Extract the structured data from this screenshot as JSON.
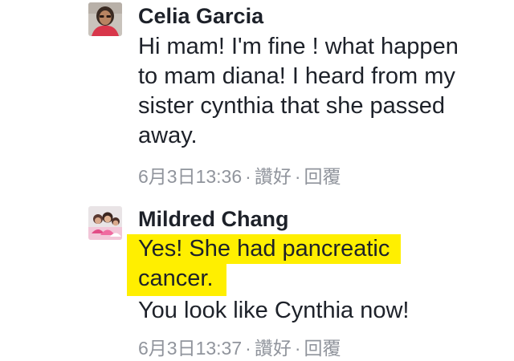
{
  "comments": [
    {
      "author": "Celia Garcia",
      "lines": [
        "Hi mam! I'm fine ! what happen",
        "to mam diana! I heard from my",
        "sister cynthia that she passed",
        "away."
      ],
      "timestamp": "6月3日13:36",
      "like_label": "讚好",
      "reply_label": "回覆",
      "separator": "·"
    },
    {
      "author": "Mildred Chang",
      "highlighted_lines": [
        "Yes! She had pancreatic",
        "cancer."
      ],
      "lines": [
        "You look like Cynthia now!"
      ],
      "timestamp": "6月3日13:37",
      "like_label": "讚好",
      "reply_label": "回覆",
      "separator": "·",
      "highlight_color": "#ffef00"
    }
  ],
  "colors": {
    "text": "#1d2129",
    "meta": "#90949c",
    "highlight": "#ffef00"
  }
}
